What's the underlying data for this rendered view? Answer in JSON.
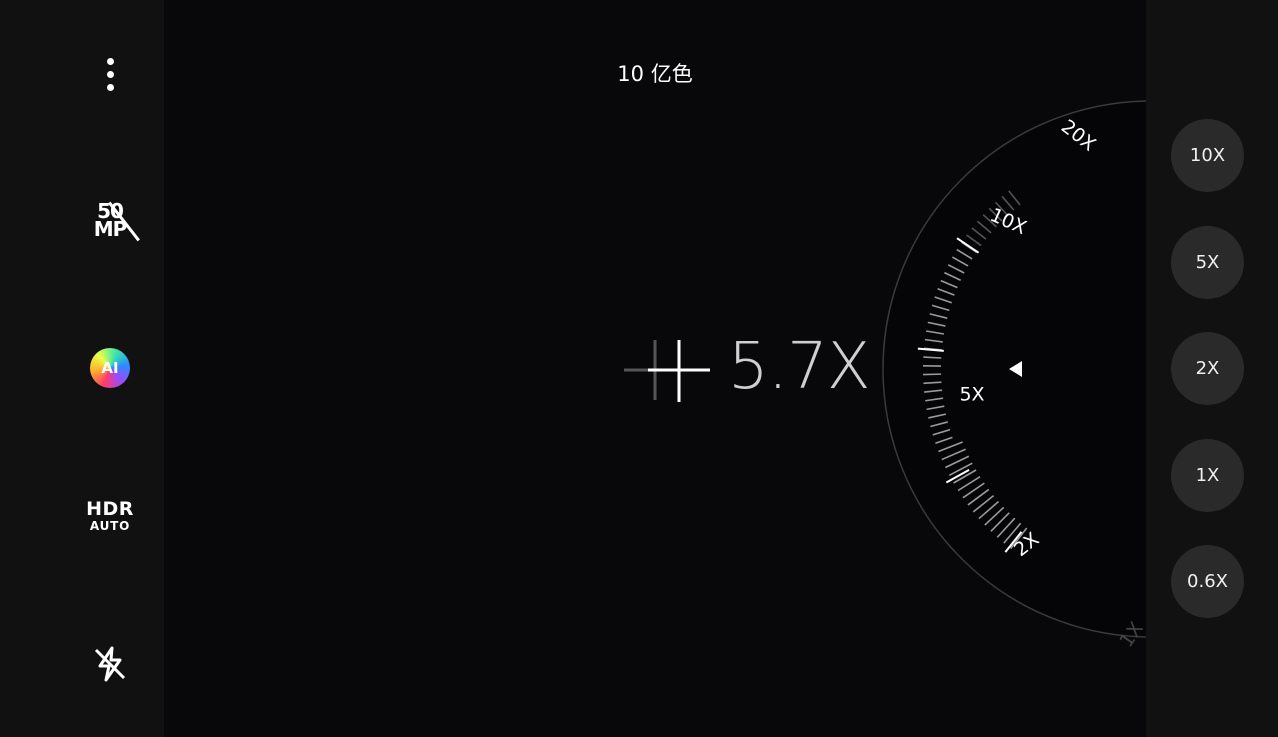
{
  "left_bar": {
    "more_icon": "more-vertical-icon",
    "megapixel_label": "50\nMP",
    "ai_label": "AI",
    "hdr": {
      "line1": "HDR",
      "line2": "AUTO"
    },
    "flash_icon": "flash-off-icon"
  },
  "viewfinder": {
    "color_label": "10 亿色",
    "zoom_readout": "5.7X",
    "dial_labels": {
      "z20": "20X",
      "z10": "10X",
      "z5": "5X",
      "z2": "2X",
      "z1": "1X"
    }
  },
  "zoom_buttons": [
    "10X",
    "5X",
    "2X",
    "1X",
    "0.6X"
  ],
  "colors": {
    "panel": "#111111",
    "viewfinder": "#08080b",
    "zoom_button": "#2a2a2a",
    "text": "#ffffff"
  }
}
